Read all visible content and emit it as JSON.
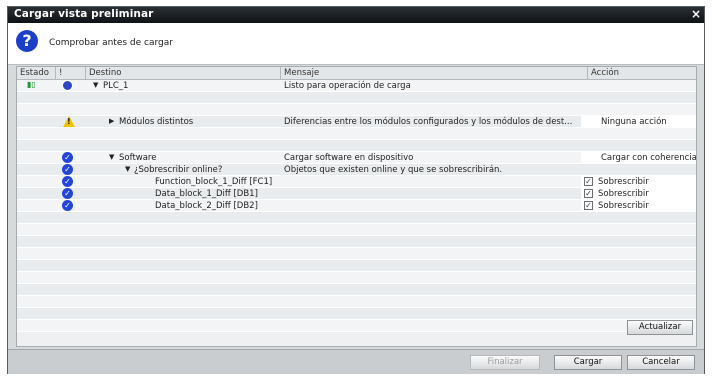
{
  "window": {
    "title": "Cargar vista preliminar",
    "close_label": "×"
  },
  "header": {
    "message": "Comprobar antes de cargar",
    "icon": "question-icon"
  },
  "columns": {
    "estado": "Estado",
    "excl": "!",
    "destino": "Destino",
    "mensaje": "Mensaje",
    "accion": "Acción"
  },
  "rows": {
    "plc": {
      "destino": "PLC_1",
      "mensaje": "Listo para operación de carga",
      "icon": "device-ok-icon"
    },
    "modulos": {
      "destino": "Módulos distintos",
      "mensaje": "Diferencias entre los módulos configurados y los módulos de dest...",
      "accion": "Ninguna acción",
      "icon": "warning-icon"
    },
    "software": {
      "destino": "Software",
      "mensaje": "Cargar software en dispositivo",
      "accion": "Cargar con coherencia",
      "icon": "check-icon"
    },
    "sobrescribir": {
      "destino": "¿Sobrescribir online?",
      "mensaje": "Objetos que existen online y que se sobrescribirán.",
      "icon": "check-icon"
    },
    "fb1": {
      "destino": "Function_block_1_Diff [FC1]",
      "accion": "Sobrescribir",
      "checked": true
    },
    "db1": {
      "destino": "Data_block_1_Diff [DB1]",
      "accion": "Sobrescribir",
      "checked": true
    },
    "db2": {
      "destino": "Data_block_2_Diff [DB2]",
      "accion": "Sobrescribir",
      "checked": true
    }
  },
  "buttons": {
    "actualizar": "Actualizar",
    "finalizar": "Finalizar",
    "cargar": "Cargar",
    "cancelar": "Cancelar"
  },
  "colors": {
    "title_bar": "#1a1e22",
    "check_blue": "#2446d6",
    "warning_yellow": "#f2c400"
  }
}
